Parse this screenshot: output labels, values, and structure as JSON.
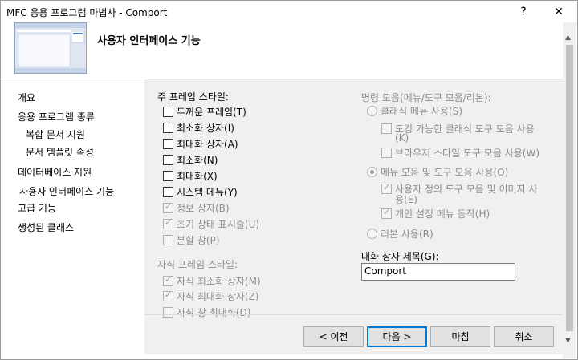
{
  "window": {
    "title": "MFC 응용 프로그램 마법사 - Comport",
    "help_glyph": "?",
    "close_glyph": "✕"
  },
  "header": {
    "title": "사용자 인터페이스 기능"
  },
  "sidebar": {
    "items": [
      {
        "label": "개요",
        "selected": false
      },
      {
        "label": "응용 프로그램 종류",
        "selected": false
      },
      {
        "label": "복합 문서 지원",
        "selected": false
      },
      {
        "label": "문서 템플릿 속성",
        "selected": false
      },
      {
        "label": "데이터베이스 지원",
        "selected": false
      },
      {
        "label": "사용자 인터페이스 기능",
        "selected": true
      },
      {
        "label": "고급 기능",
        "selected": false
      },
      {
        "label": "생성된 클래스",
        "selected": false
      }
    ]
  },
  "main_frame": {
    "heading": "주 프레임 스타일:",
    "options": [
      {
        "label": "두꺼운 프레임(T)",
        "checked": false,
        "enabled": true
      },
      {
        "label": "최소화 상자(I)",
        "checked": false,
        "enabled": true
      },
      {
        "label": "최대화 상자(A)",
        "checked": false,
        "enabled": true
      },
      {
        "label": "최소화(N)",
        "checked": false,
        "enabled": true
      },
      {
        "label": "최대화(X)",
        "checked": false,
        "enabled": true
      },
      {
        "label": "시스템 메뉴(Y)",
        "checked": false,
        "enabled": true
      },
      {
        "label": "정보 상자(B)",
        "checked": true,
        "enabled": false
      },
      {
        "label": "초기 상태 표시줄(U)",
        "checked": true,
        "enabled": false
      },
      {
        "label": "분할 창(P)",
        "checked": false,
        "enabled": false
      }
    ]
  },
  "child_frame": {
    "heading": "자식 프레임 스타일:",
    "options": [
      {
        "label": "자식 최소화 상자(M)",
        "checked": true,
        "enabled": false
      },
      {
        "label": "자식 최대화 상자(Z)",
        "checked": true,
        "enabled": false
      },
      {
        "label": "자식 창 최대화(D)",
        "checked": false,
        "enabled": false
      }
    ]
  },
  "command_bars": {
    "heading": "명령 모음(메뉴/도구 모음/리본):",
    "classic_menu": {
      "label": "클래식 메뉴 사용(S)",
      "selected": false
    },
    "docking_toolbar": {
      "label": "도킹 가능한 클래식 도구 모음 사용",
      "label2": "(K)",
      "checked": false
    },
    "browser_toolbar": {
      "label": "브라우저 스타일 도구 모음 사용(W)",
      "checked": false
    },
    "menubar_toolbar": {
      "label": "메뉴 모음 및 도구 모음 사용(O)",
      "selected": true
    },
    "user_defined": {
      "label": "사용자 정의 도구 모음 및 이미지 사",
      "label2": "용(E)",
      "checked": true
    },
    "personal_menu": {
      "label": "개인 설정 메뉴 동작(H)",
      "checked": true
    },
    "ribbon": {
      "label": "리본 사용(R)",
      "selected": false
    }
  },
  "dialog_title": {
    "label": "대화 상자 제목(G):",
    "value": "Comport"
  },
  "buttons": {
    "prev": "< 이전",
    "next": "다음 >",
    "finish": "마침",
    "cancel": "취소"
  },
  "colors": {
    "accent": "#0078d7",
    "panel": "#f0f0f0",
    "disabled_text": "#8d8d8d"
  }
}
